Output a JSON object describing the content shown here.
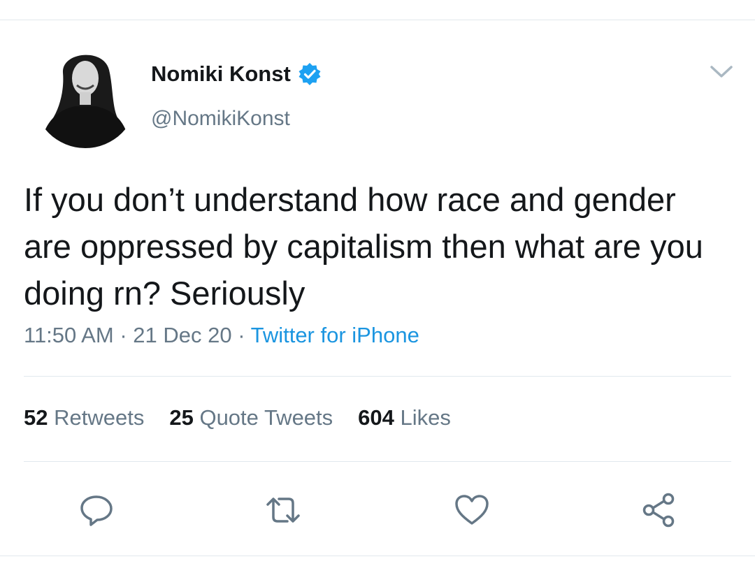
{
  "author": {
    "display_name": "Nomiki Konst",
    "handle": "@NomikiKonst",
    "verified": true
  },
  "tweet": {
    "text": "If you don’t understand how race and gender are oppressed by capitalism then what are you doing rn? Seriously",
    "time": "11:50 AM",
    "date": "21 Dec 20",
    "source": "Twitter for iPhone"
  },
  "stats": {
    "retweets_count": "52",
    "retweets_label": "Retweets",
    "quotes_count": "25",
    "quotes_label": "Quote Tweets",
    "likes_count": "604",
    "likes_label": "Likes"
  },
  "actions": [
    "reply-icon",
    "retweet-icon",
    "like-icon",
    "share-icon"
  ],
  "colors": {
    "link": "#1b95e0",
    "muted": "#657786",
    "verified": "#1da1f2",
    "divider": "#e1e8ed"
  }
}
